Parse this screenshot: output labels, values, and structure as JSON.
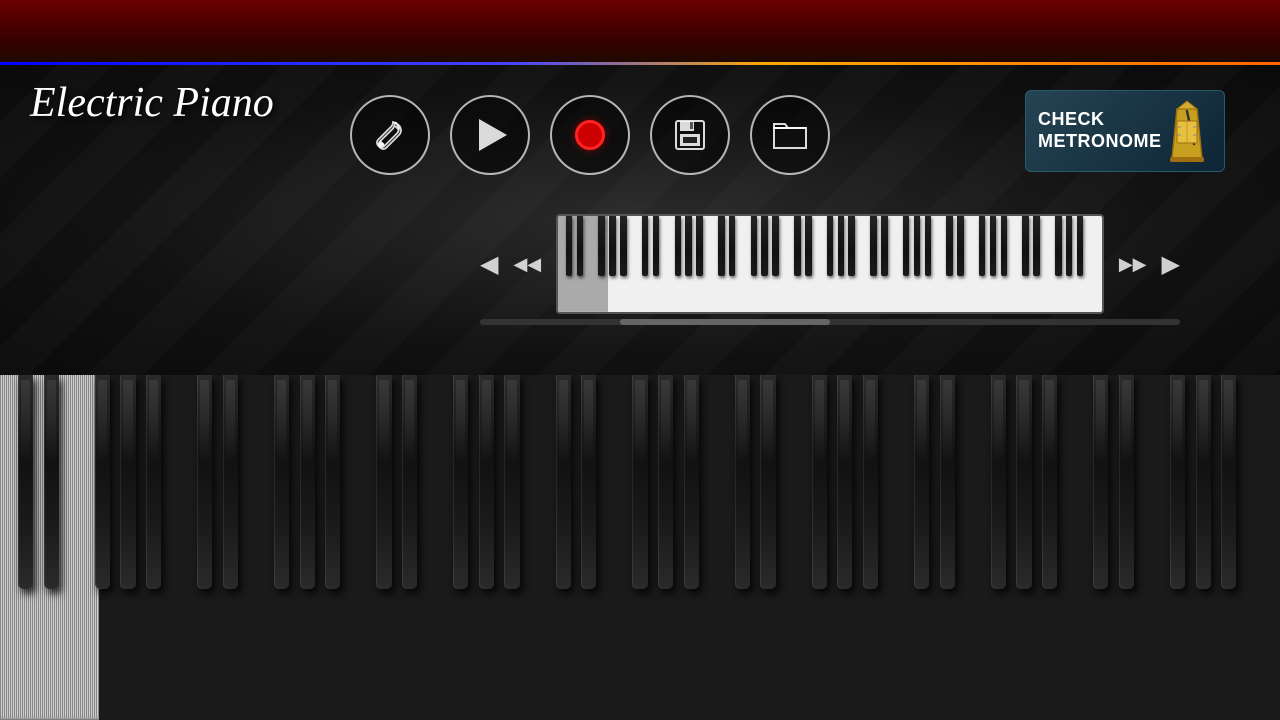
{
  "app": {
    "title": "Electric Piano"
  },
  "topBar": {
    "accentColors": [
      "#0000ff",
      "#ffaa00",
      "#ff6600"
    ]
  },
  "controls": {
    "settingsLabel": "Settings",
    "playLabel": "Play",
    "recordLabel": "Record",
    "saveLabel": "Save",
    "openLabel": "Open Folder",
    "scrollLeftFastLabel": "◀◀",
    "scrollLeftLabel": "◀",
    "scrollRightLabel": "▶",
    "scrollRightFastLabel": "▶▶"
  },
  "metronome": {
    "line1": "CHECK",
    "line2": "METRONOME",
    "label": "CHECK METRONOME"
  },
  "keyboard": {
    "whiteKeyCount": 52,
    "blackKeyPositions": [
      1,
      2,
      4,
      5,
      6,
      8,
      9,
      11,
      12,
      14,
      15,
      17,
      18,
      19,
      21,
      22,
      24,
      25,
      26,
      28,
      29,
      31,
      32,
      34,
      35,
      37,
      38,
      39,
      41,
      42,
      44,
      45,
      46,
      48,
      49,
      51
    ]
  }
}
